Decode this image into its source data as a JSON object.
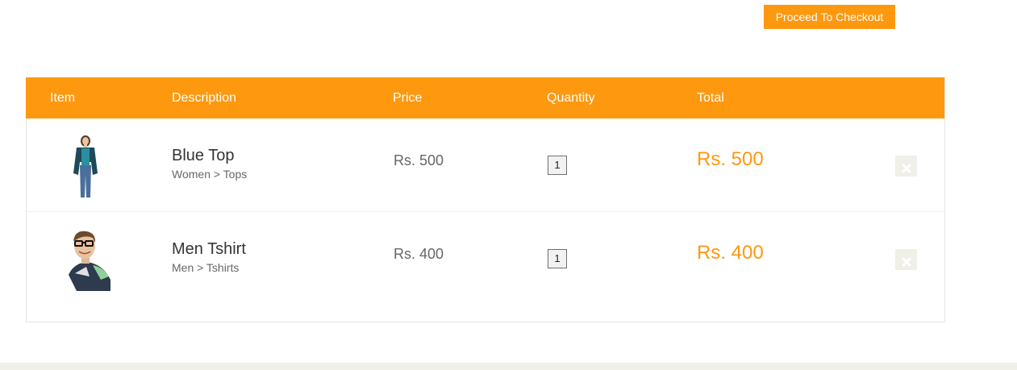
{
  "checkout": {
    "label": "Proceed To Checkout"
  },
  "table": {
    "headers": {
      "item": "Item",
      "description": "Description",
      "price": "Price",
      "quantity": "Quantity",
      "total": "Total"
    },
    "rows": [
      {
        "name": "Blue Top",
        "category": "Women > Tops",
        "price": "Rs. 500",
        "quantity": "1",
        "total": "Rs. 500",
        "image_icon": "woman-model-photo"
      },
      {
        "name": "Men Tshirt",
        "category": "Men > Tshirts",
        "price": "Rs. 400",
        "quantity": "1",
        "total": "Rs. 400",
        "image_icon": "man-model-photo"
      }
    ]
  },
  "colors": {
    "accent": "#fe980f",
    "delete_bg": "#f0f0e9",
    "footer": "#f0f0e9"
  },
  "icons": {
    "delete": "close-icon"
  }
}
